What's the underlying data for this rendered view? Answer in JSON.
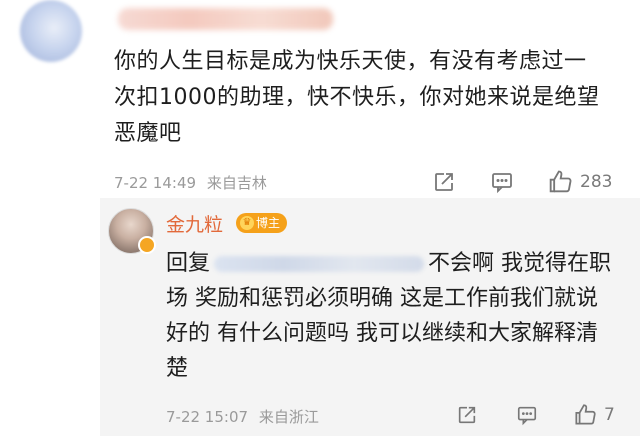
{
  "comment": {
    "body": "你的人生目标是成为快乐天使，有没有考虑过一次扣1000的助理，快不快乐，你对她来说是绝望恶魔吧",
    "date": "7-22 14:49",
    "location": "来自吉林",
    "like_count": "283"
  },
  "reply": {
    "author": "金九粒",
    "badge": "博主",
    "prefix": "回复",
    "body": "不会啊 我觉得在职场 奖励和惩罚必须明确 这是工作前我们就说好的 有什么问题吗 我可以继续和大家解释清楚",
    "date": "7-22 15:07",
    "location": "来自浙江",
    "like_count": "7"
  },
  "icons": {
    "share": "share-icon",
    "comment": "comment-icon",
    "like": "thumbs-up-icon"
  },
  "colors": {
    "author_name": "#e2693a",
    "badge": "#f5a11a",
    "meta_text": "#9a9a9a"
  }
}
